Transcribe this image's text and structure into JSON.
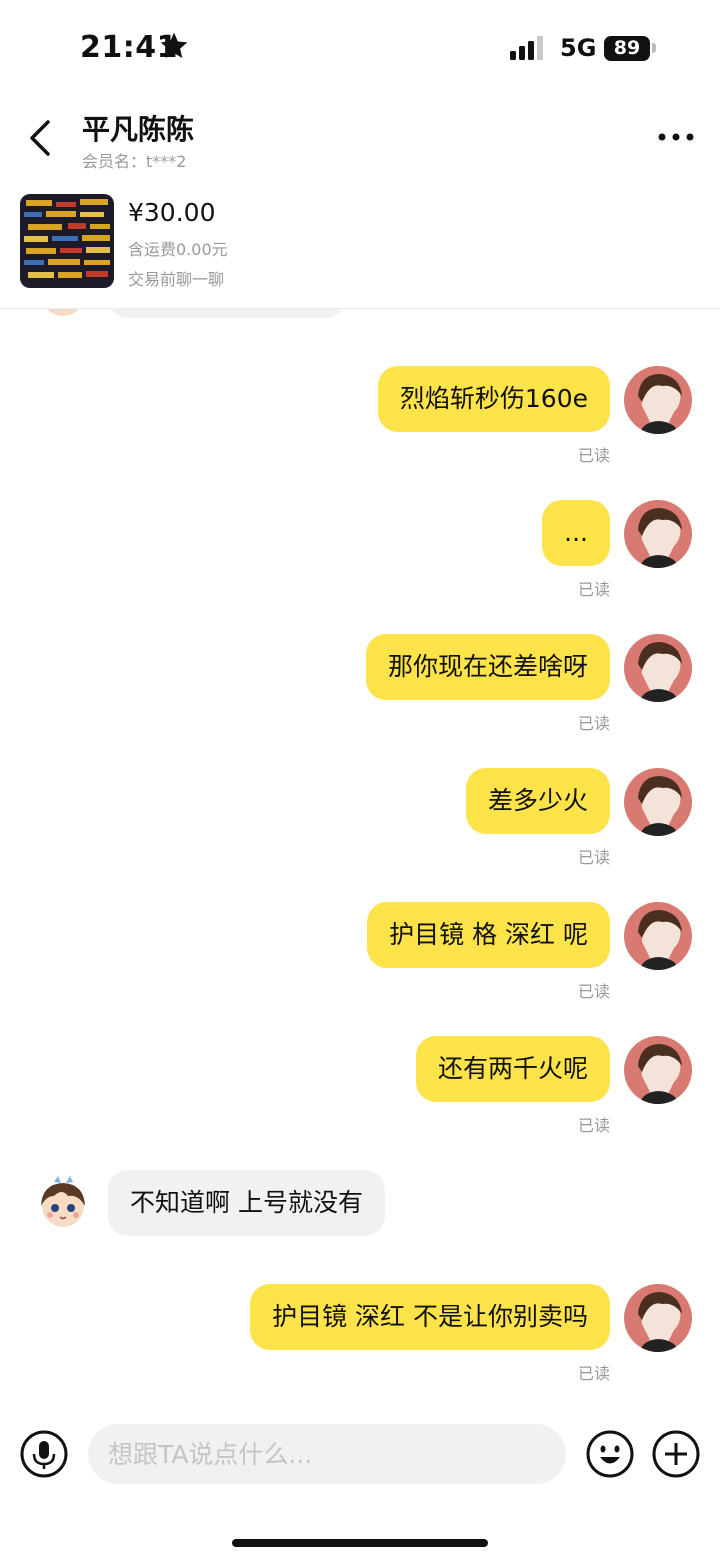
{
  "status": {
    "time": "21:41",
    "network": "5G",
    "battery": "89"
  },
  "header": {
    "title": "平凡陈陈",
    "member": "会员名：t***2"
  },
  "product": {
    "price": "¥30.00",
    "shipping": "含运费0.00元",
    "hint": "交易前聊一聊"
  },
  "messages": [
    {
      "from": "me",
      "text": "烈焰斩秒伤160e",
      "read": "已读"
    },
    {
      "from": "me",
      "text": "...",
      "read": "已读"
    },
    {
      "from": "me",
      "text": "那你现在还差啥呀",
      "read": "已读"
    },
    {
      "from": "me",
      "text": "差多少火",
      "read": "已读"
    },
    {
      "from": "me",
      "text": "护目镜 格 深红 呢",
      "read": "已读"
    },
    {
      "from": "me",
      "text": "还有两千火呢",
      "read": "已读"
    },
    {
      "from": "them",
      "text": "不知道啊 上号就没有"
    },
    {
      "from": "me",
      "text": "护目镜 深红 不是让你别卖吗",
      "read": "已读"
    }
  ],
  "input": {
    "placeholder": "想跟TA说点什么..."
  },
  "colors": {
    "my_bubble": "#fde34a",
    "their_bubble": "#f1f1f1",
    "muted_text": "#999999"
  },
  "icons": [
    "star-icon",
    "signal-icon",
    "back-arrow-icon",
    "more-icon",
    "mic-icon",
    "emoji-icon",
    "plus-icon"
  ]
}
